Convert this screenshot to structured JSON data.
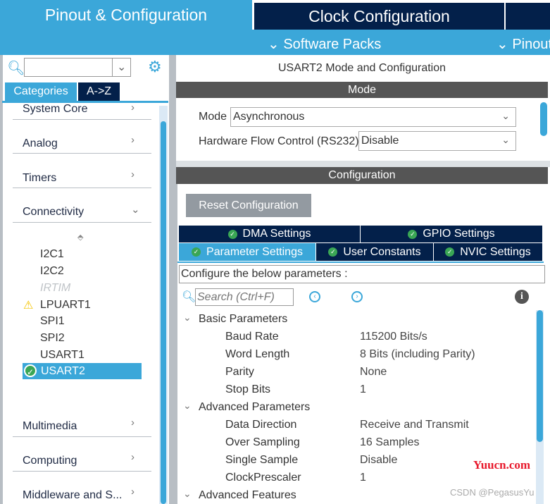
{
  "top_tabs": [
    "Pinout & Configuration",
    "Clock Configuration"
  ],
  "sub_menu": [
    "Software Packs",
    "Pinout"
  ],
  "left": {
    "search_value": "",
    "view_tabs": [
      "Categories",
      "A->Z"
    ],
    "categories_top": [
      "System Core",
      "Analog",
      "Timers",
      "Connectivity"
    ],
    "peripherals": [
      {
        "name": "I2C1",
        "status": "none"
      },
      {
        "name": "I2C2",
        "status": "none"
      },
      {
        "name": "IRTIM",
        "status": "disabled"
      },
      {
        "name": "LPUART1",
        "status": "warning"
      },
      {
        "name": "SPI1",
        "status": "none"
      },
      {
        "name": "SPI2",
        "status": "none"
      },
      {
        "name": "USART1",
        "status": "none"
      },
      {
        "name": "USART2",
        "status": "configured-selected"
      }
    ],
    "categories_bottom": [
      "Multimedia",
      "Computing",
      "Middleware and S..."
    ]
  },
  "right": {
    "title": "USART2 Mode and Configuration",
    "mode_header": "Mode",
    "mode_label": "Mode",
    "mode_value": "Asynchronous",
    "hwflow_label": "Hardware Flow Control (RS232)",
    "hwflow_value": "Disable",
    "config_header": "Configuration",
    "reset_label": "Reset Configuration",
    "tabs_row1": [
      "DMA Settings",
      "GPIO Settings"
    ],
    "tabs_row2": [
      "Parameter Settings",
      "User Constants",
      "NVIC Settings"
    ],
    "active_tab": "Parameter Settings",
    "configure_text": "Configure the below parameters :",
    "search_placeholder": "Search (Ctrl+F)",
    "groups": [
      {
        "name": "Basic Parameters",
        "params": [
          [
            "Baud Rate",
            "115200 Bits/s"
          ],
          [
            "Word Length",
            "8 Bits (including Parity)"
          ],
          [
            "Parity",
            "None"
          ],
          [
            "Stop Bits",
            "1"
          ]
        ]
      },
      {
        "name": "Advanced Parameters",
        "params": [
          [
            "Data Direction",
            "Receive and Transmit"
          ],
          [
            "Over Sampling",
            "16 Samples"
          ],
          [
            "Single Sample",
            "Disable"
          ],
          [
            "ClockPrescaler",
            "1"
          ]
        ]
      },
      {
        "name": "Advanced Features",
        "params": []
      }
    ]
  },
  "watermarks": [
    "Yuucn.com",
    "CSDN @PegasusYu"
  ],
  "colors": {
    "accent": "#3ba7d9",
    "navy": "#03204a",
    "header_gray": "#555555",
    "check": "#3aa655",
    "warning": "#f5c400"
  }
}
